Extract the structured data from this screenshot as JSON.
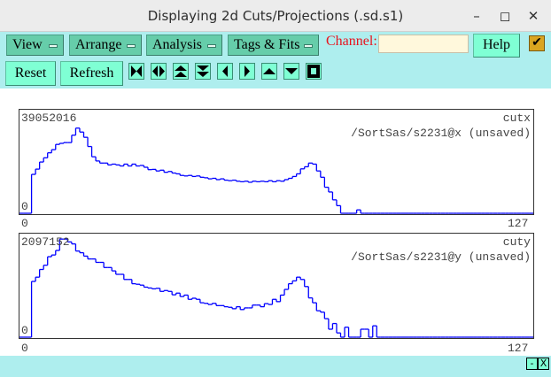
{
  "window": {
    "title": "Displaying 2d Cuts/Projections (.sd.s1)",
    "minimize": "–",
    "maximize": "◻",
    "close": "✕"
  },
  "menus": [
    {
      "label": "View"
    },
    {
      "label": "Arrange"
    },
    {
      "label": "Analysis"
    },
    {
      "label": "Tags & Fits"
    }
  ],
  "channel": {
    "label": "Channel:",
    "value": ""
  },
  "help_label": "Help",
  "checkbox": {
    "checked": true,
    "glyph": "✔",
    "color": "#daa520"
  },
  "buttons": {
    "reset": "Reset",
    "refresh": "Refresh"
  },
  "icon_buttons": [
    "expand-horizontal",
    "compress-horizontal",
    "expand-vertical",
    "compress-vertical",
    "scroll-left",
    "scroll-right",
    "scroll-up",
    "scroll-down",
    "full-view"
  ],
  "colors": {
    "toolbar_bg": "#aeeeee",
    "menu_bg": "#66cdaa",
    "button_bg": "#7fffd4",
    "trace": "#0000ff",
    "channel_label": "#e8141e"
  },
  "bottom": {
    "minimize": "-",
    "close": "X"
  },
  "chart_data": [
    {
      "type": "histogram",
      "name": "cutx",
      "subtitle": "/SortSas/s2231@x (unsaved)",
      "ymax_label": "39052016",
      "ymin_label": "0",
      "xmin_label": "0",
      "xmax_label": "127",
      "xlim": [
        0,
        127
      ],
      "ylim": [
        0,
        39052016
      ],
      "values": [
        0,
        0,
        0,
        14800000,
        16800000,
        19500000,
        21100000,
        23000000,
        24200000,
        26200000,
        26600000,
        26900000,
        26900000,
        29700000,
        32400000,
        30900000,
        28900000,
        25400000,
        21500000,
        19900000,
        19100000,
        19100000,
        18400000,
        18700000,
        18400000,
        18000000,
        18700000,
        18000000,
        18700000,
        18000000,
        18200000,
        17500000,
        16600000,
        16700000,
        16100000,
        16400000,
        15600000,
        15900000,
        15300000,
        15000000,
        14400000,
        14200000,
        14400000,
        14000000,
        14200000,
        13700000,
        13500000,
        13100000,
        13300000,
        12800000,
        13100000,
        12600000,
        12400000,
        12600000,
        12200000,
        12000000,
        12200000,
        11800000,
        12200000,
        12000000,
        12200000,
        12000000,
        12400000,
        12000000,
        12400000,
        12200000,
        12800000,
        13300000,
        14000000,
        15000000,
        16900000,
        17700000,
        19100000,
        18700000,
        16100000,
        13700000,
        9900000,
        8100000,
        5100000,
        2900000,
        0,
        0,
        0,
        0,
        1300000,
        0,
        0,
        0,
        0,
        0,
        0,
        0,
        0,
        0,
        0,
        0,
        0,
        0,
        0,
        0,
        0,
        0,
        0,
        0,
        0,
        0,
        0,
        0,
        0,
        0,
        0,
        0,
        0,
        0,
        0,
        0,
        0,
        0,
        0,
        0,
        0,
        0,
        0,
        0,
        0,
        0,
        0,
        0
      ]
    },
    {
      "type": "histogram",
      "name": "cuty",
      "subtitle": "/SortSas/s2231@y (unsaved)",
      "ymax_label": "2097152",
      "ymin_label": "0",
      "xmin_label": "0",
      "xmax_label": "127",
      "xlim": [
        0,
        127
      ],
      "ylim": [
        0,
        2097152
      ],
      "values": [
        0,
        0,
        0,
        1139000,
        1226000,
        1383000,
        1470000,
        1644000,
        1679000,
        1772000,
        2004000,
        2004000,
        1946000,
        1905000,
        1760000,
        1725000,
        1656000,
        1598000,
        1598000,
        1528000,
        1528000,
        1423000,
        1423000,
        1354000,
        1284000,
        1284000,
        1179000,
        1179000,
        1092000,
        1081000,
        1063000,
        1022000,
        1005000,
        988000,
        999000,
        935000,
        953000,
        935000,
        866000,
        900000,
        831000,
        860000,
        773000,
        796000,
        773000,
        703000,
        691000,
        668000,
        691000,
        645000,
        645000,
        622000,
        610000,
        581000,
        622000,
        564000,
        598000,
        598000,
        656000,
        656000,
        622000,
        685000,
        668000,
        773000,
        726000,
        860000,
        976000,
        1092000,
        1150000,
        1226000,
        1179000,
        1034000,
        802000,
        703000,
        540000,
        511000,
        378000,
        163000,
        279000,
        87000,
        0,
        203000,
        0,
        0,
        0,
        163000,
        163000,
        0,
        232000,
        0,
        0,
        0,
        0,
        0,
        0,
        0,
        0,
        0,
        0,
        0,
        0,
        0,
        0,
        0,
        0,
        0,
        0,
        0,
        0,
        0,
        0,
        0,
        0,
        0,
        0,
        0,
        0,
        0,
        0,
        0,
        0,
        0,
        0,
        0,
        0,
        0,
        0,
        0,
        0,
        0
      ]
    }
  ]
}
